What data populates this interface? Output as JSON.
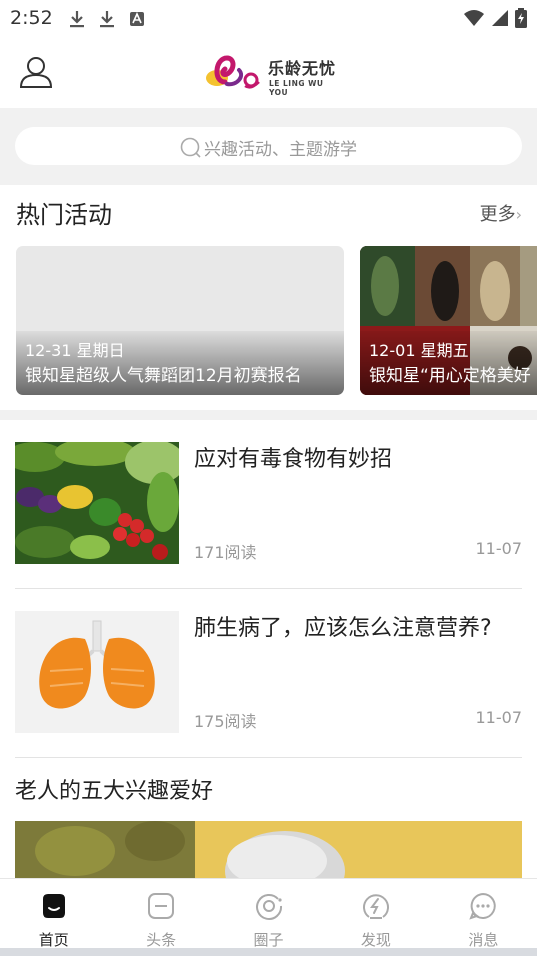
{
  "status_bar": {
    "time": "2:52"
  },
  "header": {
    "logo_cn": "乐龄无忧",
    "logo_en": "LE LING WU YOU"
  },
  "search": {
    "placeholder": "兴趣活动、主题游学"
  },
  "hot": {
    "title": "热门活动",
    "more": "更多",
    "cards": [
      {
        "date": "12-31 星期日",
        "title": "银知星超级人气舞蹈团12月初赛报名"
      },
      {
        "date": "12-01 星期五",
        "title": "银知星“用心定格美好"
      }
    ]
  },
  "articles": [
    {
      "title": "应对有毒食物有妙招",
      "reads": "171阅读",
      "date": "11-07",
      "thumb": "vegetables"
    },
    {
      "title": "肺生病了，应该怎么注意营养?",
      "reads": "175阅读",
      "date": "11-07",
      "thumb": "orange-lungs"
    }
  ],
  "feature": {
    "title": "老人的五大兴趣爱好"
  },
  "nav": [
    {
      "label": "首页",
      "icon": "home-icon",
      "active": true
    },
    {
      "label": "头条",
      "icon": "headline-icon",
      "active": false
    },
    {
      "label": "圈子",
      "icon": "circle-icon",
      "active": false
    },
    {
      "label": "发现",
      "icon": "discover-icon",
      "active": false
    },
    {
      "label": "消息",
      "icon": "message-icon",
      "active": false
    }
  ],
  "colors": {
    "accent": "#222222",
    "muted": "#999999",
    "band": "#f1f1f1"
  }
}
